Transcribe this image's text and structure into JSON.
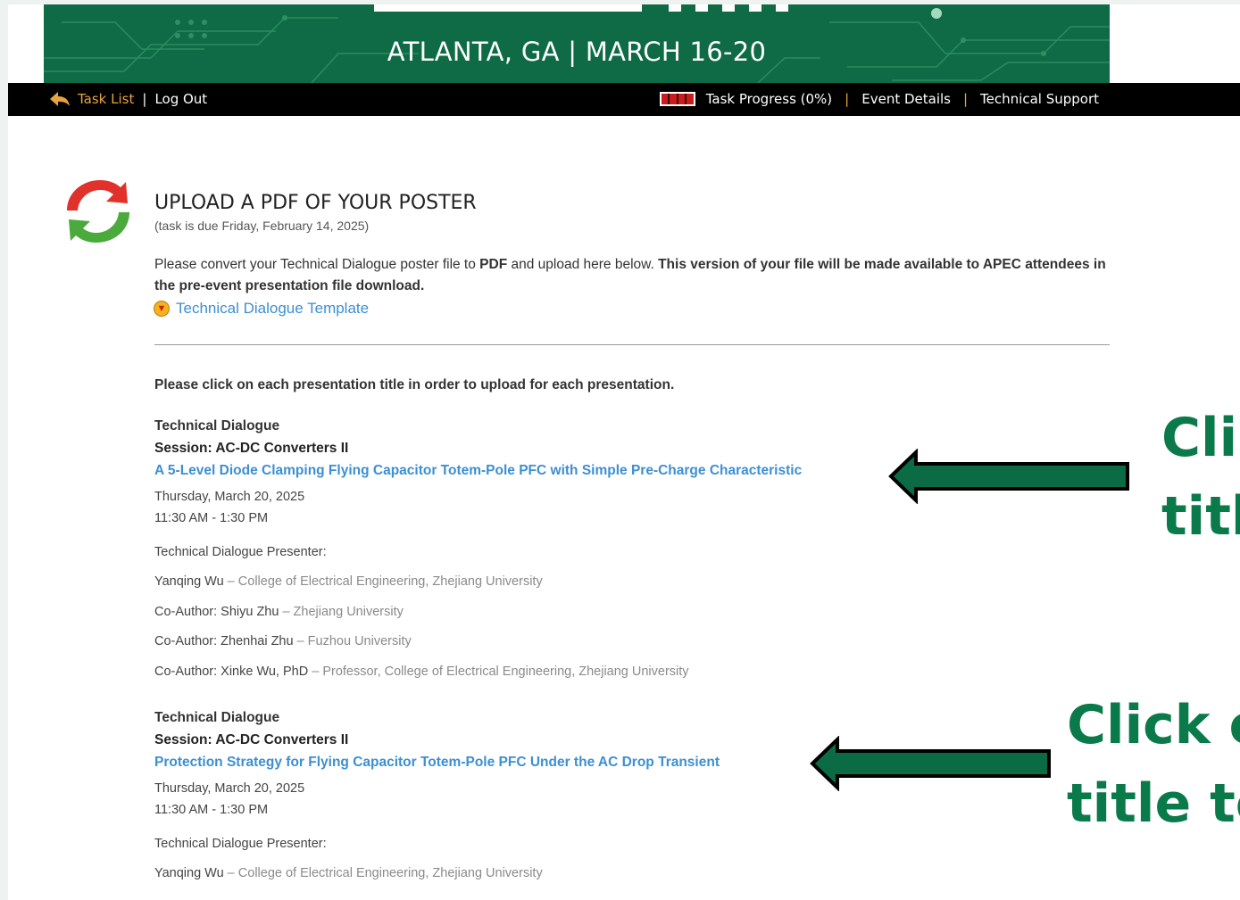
{
  "banner": {
    "subtitle": "ATLANTA, GA  |  MARCH 16-20"
  },
  "nav": {
    "task_list": "Task List",
    "log_out": "Log Out",
    "task_progress": "Task Progress (0%)",
    "event_details": "Event Details",
    "technical_support": "Technical Support",
    "separator": "|",
    "progress_percent": 0
  },
  "task": {
    "title": "UPLOAD A PDF OF YOUR POSTER",
    "due": "(task is due Friday, February 14, 2025)",
    "desc_part1": "Please convert your Technical Dialogue poster file to ",
    "desc_bold1": "PDF",
    "desc_part2": " and upload here below. ",
    "desc_bold2": "This version of your file will be made available to APEC attendees in the pre-event presentation file download.",
    "template_link": "Technical Dialogue Template",
    "instructions": "Please click on each presentation title in order to upload for each presentation."
  },
  "presentations": [
    {
      "type": "Technical Dialogue",
      "session": "Session: AC-DC Converters II",
      "title": "A 5-Level Diode Clamping Flying Capacitor Totem-Pole PFC with Simple Pre-Charge Characteristic",
      "date": "Thursday, March 20, 2025",
      "time": "11:30 AM - 1:30 PM",
      "presenter_label": "Technical Dialogue Presenter:",
      "people": [
        {
          "name": "Yanqing Wu",
          "affil": " – College of Electrical Engineering, Zhejiang University"
        },
        {
          "name": "Co-Author: Shiyu Zhu",
          "affil": " – Zhejiang University"
        },
        {
          "name": "Co-Author: Zhenhai Zhu",
          "affil": " – Fuzhou University"
        },
        {
          "name": "Co-Author: Xinke Wu, PhD",
          "affil": " – Professor, College of Electrical Engineering, Zhejiang University"
        }
      ]
    },
    {
      "type": "Technical Dialogue",
      "session": "Session: AC-DC Converters II",
      "title": "Protection Strategy for Flying Capacitor Totem-Pole PFC Under the AC Drop Transient",
      "date": "Thursday, March 20, 2025",
      "time": "11:30 AM - 1:30 PM",
      "presenter_label": "Technical Dialogue Presenter:",
      "people": [
        {
          "name": "Yanqing Wu",
          "affil": " – College of Electrical Engineering, Zhejiang University"
        }
      ]
    }
  ],
  "callouts": {
    "first_line1": "Cli",
    "first_line2": "titl",
    "second_line1": "Click o",
    "second_line2": "title to"
  },
  "colors": {
    "banner_green": "#0e6b45",
    "link_blue": "#3d8fd1",
    "callout_green": "#0b7a4a",
    "progress_red": "#c91d1d",
    "nav_orange": "#e8a33d"
  }
}
